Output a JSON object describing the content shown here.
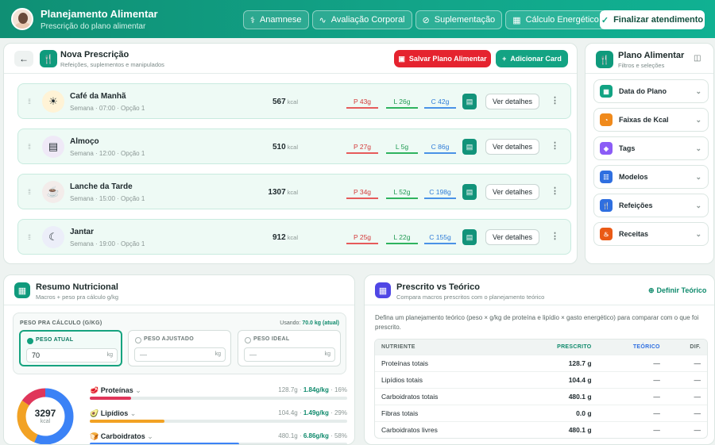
{
  "header": {
    "title": "Planejamento Alimentar",
    "subtitle": "Prescrição do plano alimentar",
    "nav": [
      {
        "label": "Anamnese",
        "icon": "stethoscope-icon"
      },
      {
        "label": "Avaliação Corporal",
        "icon": "activity-icon"
      },
      {
        "label": "Suplementação",
        "icon": "pill-icon"
      },
      {
        "label": "Cálculo Energético",
        "icon": "calculator-icon"
      }
    ],
    "finalize_label": "Finalizar atendimento"
  },
  "prescription": {
    "title": "Nova Prescrição",
    "subtitle": "Refeições, suplementos e manipulados",
    "save_label": "Salvar Plano Alimentar",
    "add_label": "Adicionar Card",
    "meals": [
      {
        "name": "Café da Manhã",
        "day": "Semana",
        "time": "07:00",
        "option": "Opção 1",
        "kcal": "567",
        "unit": "kcal",
        "p": "P 43g",
        "l": "L 26g",
        "c": "C 42g",
        "details": "Ver detalhes",
        "icon": "sun-icon"
      },
      {
        "name": "Almoço",
        "day": "Semana",
        "time": "12:00",
        "option": "Opção 1",
        "kcal": "510",
        "unit": "kcal",
        "p": "P 27g",
        "l": "L 5g",
        "c": "C 86g",
        "details": "Ver detalhes",
        "icon": "plate-icon"
      },
      {
        "name": "Lanche da Tarde",
        "day": "Semana",
        "time": "15:00",
        "option": "Opção 1",
        "kcal": "1307",
        "unit": "kcal",
        "p": "P 34g",
        "l": "L 52g",
        "c": "C 198g",
        "details": "Ver detalhes",
        "icon": "cup-icon"
      },
      {
        "name": "Jantar",
        "day": "Semana",
        "time": "19:00",
        "option": "Opção 1",
        "kcal": "912",
        "unit": "kcal",
        "p": "P 25g",
        "l": "L 22g",
        "c": "C 155g",
        "details": "Ver detalhes",
        "icon": "moon-icon"
      }
    ]
  },
  "sidebar": {
    "title": "Plano Alimentar",
    "subtitle": "Filtros e seleções",
    "items": [
      {
        "label": "Data do Plano",
        "color": "#12a383",
        "icon": "calendar-icon"
      },
      {
        "label": "Faixas de Kcal",
        "color": "#f08a1c",
        "icon": "gauge-icon"
      },
      {
        "label": "Tags",
        "color": "#8b5cf6",
        "icon": "tag-icon"
      },
      {
        "label": "Modelos",
        "color": "#2f6fe0",
        "icon": "template-icon"
      },
      {
        "label": "Refeições",
        "color": "#2f6fe0",
        "icon": "utensils-icon"
      },
      {
        "label": "Receitas",
        "color": "#ea5a16",
        "icon": "chef-icon"
      }
    ]
  },
  "summary": {
    "title": "Resumo Nutricional",
    "subtitle": "Macros + peso pra cálculo g/kg",
    "weight_label": "PESO PRA CÁLCULO (G/KG)",
    "using_prefix": "Usando:",
    "using_value": "70.0 kg (atual)",
    "options": [
      {
        "label": "PESO ATUAL",
        "value": "70",
        "unit": "kg"
      },
      {
        "label": "PESO AJUSTADO",
        "value": "—",
        "unit": "kg"
      },
      {
        "label": "PESO IDEAL",
        "value": "—",
        "unit": "kg"
      }
    ],
    "total_kcal": "3297",
    "kcal_unit": "kcal",
    "macros": [
      {
        "name": "Proteínas",
        "grams": "128.7g",
        "gkg": "1.84g/kg",
        "pct": "16%",
        "fraction": 0.16,
        "color": "#e0365a"
      },
      {
        "name": "Lipídios",
        "grams": "104.4g",
        "gkg": "1.49g/kg",
        "pct": "29%",
        "fraction": 0.29,
        "color": "#f2a224"
      },
      {
        "name": "Carboidratos",
        "grams": "480.1g",
        "gkg": "6.86g/kg",
        "pct": "58%",
        "fraction": 0.58,
        "color": "#3b82f6"
      }
    ]
  },
  "compare": {
    "title": "Prescrito vs Teórico",
    "subtitle": "Compara macros prescritos com o planejamento teórico",
    "define_label": "Definir Teórico",
    "description": "Defina um planejamento teórico (peso × g/kg de proteína e lipídio × gasto energético) para comparar com o que foi prescrito.",
    "columns": [
      "NUTRIENTE",
      "PRESCRITO",
      "TEÓRICO",
      "DIF."
    ],
    "rows": [
      {
        "name": "Proteínas totais",
        "prescribed": "128.7 g",
        "theoretical": "—",
        "diff": "—"
      },
      {
        "name": "Lipídios totais",
        "prescribed": "104.4 g",
        "theoretical": "—",
        "diff": "—"
      },
      {
        "name": "Carboidratos totais",
        "prescribed": "480.1 g",
        "theoretical": "—",
        "diff": "—"
      },
      {
        "name": "Fibras totais",
        "prescribed": "0.0 g",
        "theoretical": "—",
        "diff": "—"
      },
      {
        "name": "Carboidratos livres",
        "prescribed": "480.1 g",
        "theoretical": "—",
        "diff": "—"
      }
    ]
  }
}
